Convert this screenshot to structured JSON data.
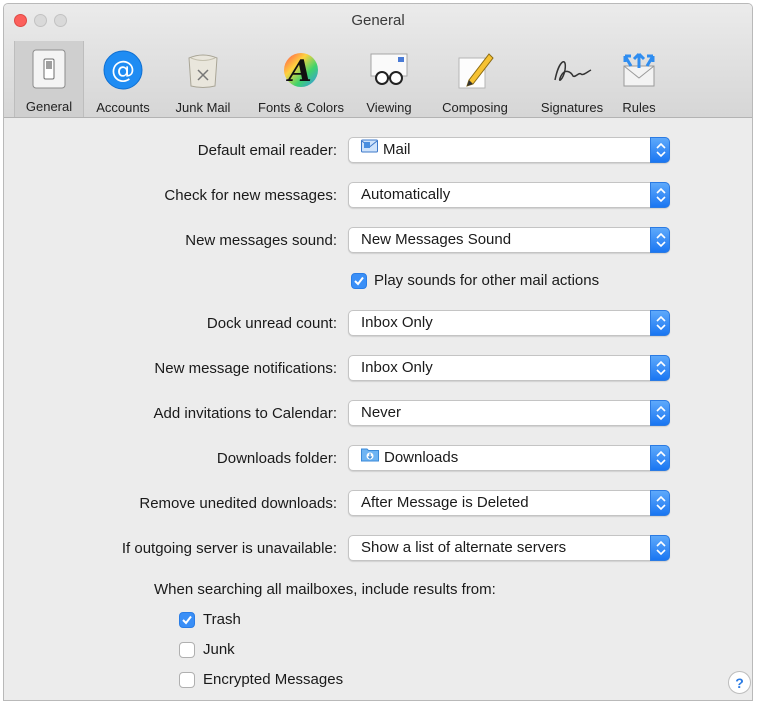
{
  "window": {
    "title": "General"
  },
  "toolbar": {
    "items": [
      {
        "label": "General",
        "icon": "general-switch-icon",
        "selected": true
      },
      {
        "label": "Accounts",
        "icon": "at-sign-icon"
      },
      {
        "label": "Junk Mail",
        "icon": "junk-bin-icon"
      },
      {
        "label": "Fonts & Colors",
        "icon": "fonts-colors-icon"
      },
      {
        "label": "Viewing",
        "icon": "glasses-icon"
      },
      {
        "label": "Composing",
        "icon": "pencil-icon"
      },
      {
        "label": "Signatures",
        "icon": "signature-icon"
      },
      {
        "label": "Rules",
        "icon": "rules-envelope-icon"
      }
    ]
  },
  "settings": {
    "default_email_reader": {
      "label": "Default email reader:",
      "value": "Mail"
    },
    "check_new_messages": {
      "label": "Check for new messages:",
      "value": "Automatically"
    },
    "new_messages_sound": {
      "label": "New messages sound:",
      "value": "New Messages Sound"
    },
    "play_sounds": {
      "label": "Play sounds for other mail actions",
      "checked": true
    },
    "dock_unread_count": {
      "label": "Dock unread count:",
      "value": "Inbox Only"
    },
    "new_message_notifications": {
      "label": "New message notifications:",
      "value": "Inbox Only"
    },
    "add_invitations": {
      "label": "Add invitations to Calendar:",
      "value": "Never"
    },
    "downloads_folder": {
      "label": "Downloads folder:",
      "value": "Downloads"
    },
    "remove_unedited": {
      "label": "Remove unedited downloads:",
      "value": "After Message is Deleted"
    },
    "outgoing_unavailable": {
      "label": "If outgoing server is unavailable:",
      "value": "Show a list of alternate servers"
    }
  },
  "search": {
    "label": "When searching all mailboxes, include results from:",
    "options": [
      {
        "label": "Trash",
        "checked": true
      },
      {
        "label": "Junk",
        "checked": false
      },
      {
        "label": "Encrypted Messages",
        "checked": false
      }
    ]
  },
  "help": {
    "label": "?"
  },
  "colors": {
    "accent": "#3a8ff7",
    "close": "#fc605c"
  }
}
